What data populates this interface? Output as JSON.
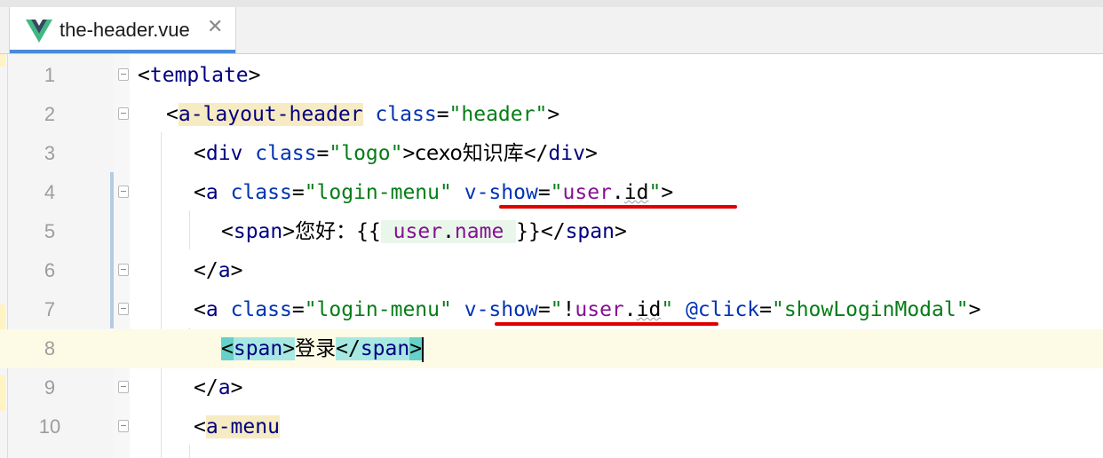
{
  "tab": {
    "label": "the-header.vue",
    "icon": "vue-logo-icon",
    "close_icon": "close-icon",
    "close_glyph": "✕",
    "active_color": "#4a8ad8"
  },
  "editor": {
    "current_line": 8,
    "lines": [
      {
        "number": "1"
      },
      {
        "number": "2"
      },
      {
        "number": "3"
      },
      {
        "number": "4"
      },
      {
        "number": "5"
      },
      {
        "number": "6"
      },
      {
        "number": "7"
      },
      {
        "number": "8"
      },
      {
        "number": "9"
      },
      {
        "number": "10"
      }
    ]
  },
  "code": {
    "l1": {
      "open": "<",
      "tag": "template",
      "close": ">"
    },
    "l2": {
      "open": "<",
      "tag": "a-layout-header",
      "attr": "class",
      "eq": "=",
      "val": "\"header\"",
      "close": ">"
    },
    "l3": {
      "open": "<",
      "tag": "div",
      "attr": "class",
      "eq": "=",
      "val": "\"logo\"",
      "close": ">",
      "text": "cexo知识库",
      "end_open": "</",
      "end_tag": "div",
      "end_close": ">"
    },
    "l4": {
      "open": "<",
      "tag": "a",
      "attr1": "class",
      "eq1": "=",
      "val1": "\"login-menu\"",
      "attr2": "v-show",
      "eq2": "=",
      "q1": "\"",
      "expr_obj": "user",
      "dot": ".",
      "expr_prop": "id",
      "q2": "\"",
      "close": ">"
    },
    "l5": {
      "open": "<",
      "tag": "span",
      "close": ">",
      "text": "您好：",
      "mustache_open": "{{",
      "expr_obj": "user",
      "dot": ".",
      "expr_prop": "name",
      "mustache_close": "}}",
      "end_open": "</",
      "end_tag": "span",
      "end_close": ">"
    },
    "l6": {
      "end_open": "</",
      "end_tag": "a",
      "end_close": ">"
    },
    "l7": {
      "open": "<",
      "tag": "a",
      "attr1": "class",
      "eq1": "=",
      "val1": "\"login-menu\"",
      "attr2": "v-show",
      "eq2": "=",
      "q1": "\"",
      "bang": "!",
      "expr_obj": "user",
      "dot": ".",
      "expr_prop": "id",
      "q2": "\"",
      "attr3": "@click",
      "eq3": "=",
      "val3": "\"showLoginModal\"",
      "close": ">"
    },
    "l8": {
      "open": "<",
      "tag": "span",
      "close": ">",
      "text": "登录",
      "end_open": "</",
      "end_tag": "span",
      "end_close": ">"
    },
    "l9": {
      "end_open": "</",
      "end_tag": "a",
      "end_close": ">"
    },
    "l10": {
      "open": "<",
      "tag": "a-menu"
    }
  },
  "colors": {
    "tag": "#000080",
    "attribute": "#0033b3",
    "string": "#067d17",
    "expression": "#871094",
    "annotation_underline": "#e00000",
    "current_line": "#fdfbe6"
  }
}
